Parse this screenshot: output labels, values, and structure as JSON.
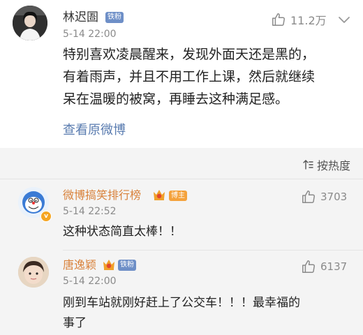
{
  "post": {
    "author": "林迟圄",
    "fan_badge": "铁粉",
    "time": "5-14 22:00",
    "likes": "11.2万",
    "text_lines": [
      "特别喜欢凌晨醒来，发现外面天还是黑的，",
      "有着雨声，并且不用工作上课，然后就继续",
      "呆在温暖的被窝，再睡去这种满足感。"
    ],
    "view_original": "查看原微博"
  },
  "comments": {
    "sort_label": "按热度",
    "items": [
      {
        "author": "微博搞笑排行榜",
        "badge": "博主",
        "verified": "v",
        "time": "5-14 22:52",
        "likes": "3703",
        "text_lines": [
          "这种状态简直太棒！！"
        ]
      },
      {
        "author": "唐逸颖",
        "badge": "铁粉",
        "time": "5-14 22:00",
        "likes": "6137",
        "text_lines": [
          "刚到车站就刚好赶上了公交车！！！最幸福的",
          "事了"
        ]
      }
    ]
  },
  "colors": {
    "link_blue": "#5a7cb0",
    "commenter_orange": "#d9823b",
    "fan_badge": "#6e8fc7",
    "host_badge": "#f4a23c",
    "comments_bg": "#f4f4f4"
  },
  "icons": {
    "like": "thumbs-up-icon",
    "more": "chevron-down-icon",
    "sort": "sort-icon",
    "crown": "crown-icon"
  }
}
